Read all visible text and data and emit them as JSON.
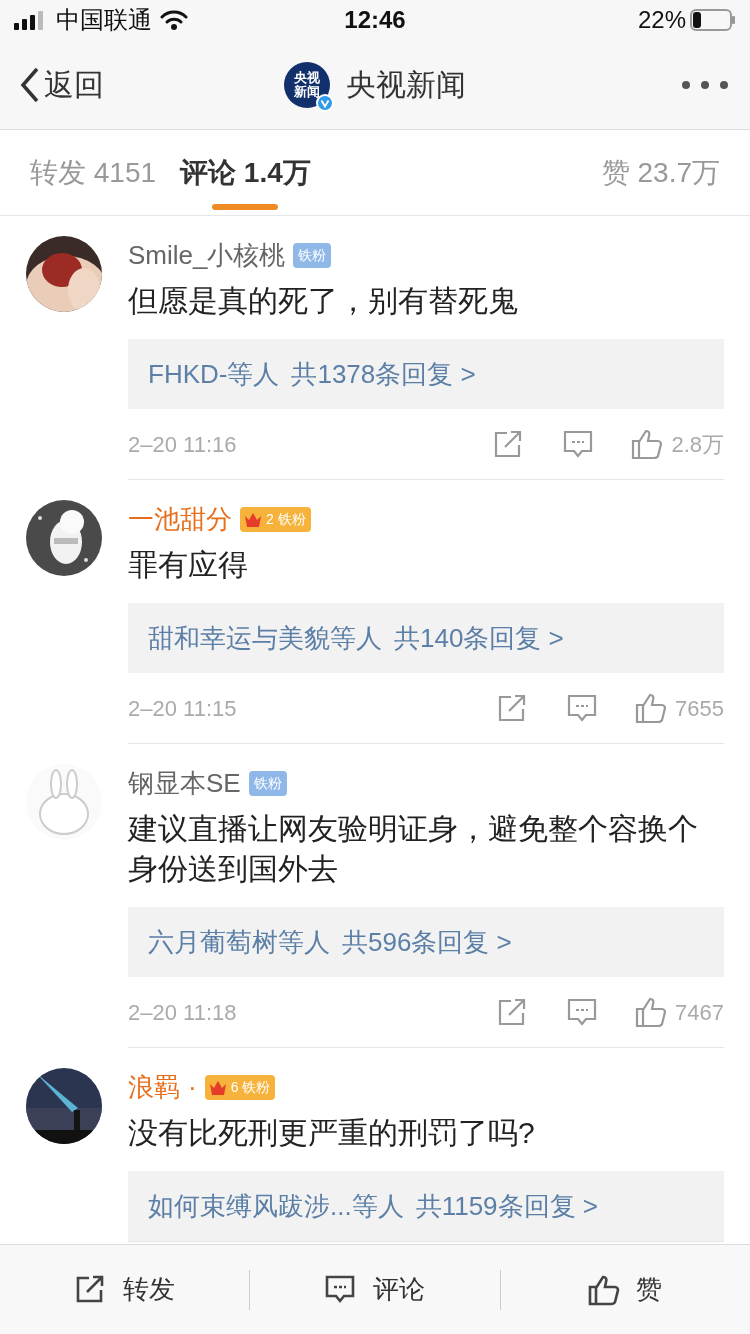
{
  "status_bar": {
    "carrier": "中国联通",
    "time": "12:46",
    "battery": "22%"
  },
  "nav": {
    "back": "返回",
    "logo_lines": [
      "央视",
      "新闻"
    ],
    "verified": true,
    "account": "央视新闻"
  },
  "tabs": [
    {
      "label": "转发",
      "count": "4151",
      "selected": false
    },
    {
      "label": "评论",
      "count": "1.4万",
      "selected": true
    },
    {
      "label": "赞",
      "count": "23.7万",
      "selected": false
    }
  ],
  "comments": [
    {
      "name": "Smile_小核桃",
      "vip": false,
      "badge": {
        "kind": "plain",
        "label": "铁粉"
      },
      "text": "但愿是真的死了，别有替死鬼",
      "replies": {
        "who": "FHKD-等人",
        "total": "共1378条回复 >"
      },
      "time": "2–20 11:16",
      "likes": "2.8万"
    },
    {
      "name": "一池甜分",
      "vip": true,
      "badge": {
        "kind": "crown",
        "label": "铁粉",
        "rank": "2"
      },
      "text": "罪有应得",
      "replies": {
        "who": "甜和幸运与美貌等人",
        "total": "共140条回复 >"
      },
      "time": "2–20 11:15",
      "likes": "7655"
    },
    {
      "name": "钢显本SE",
      "vip": false,
      "badge": {
        "kind": "plain",
        "label": "铁粉"
      },
      "text": "建议直播让网友验明证身，避免整个容换个身份送到国外去",
      "replies": {
        "who": "六月葡萄树等人",
        "total": "共596条回复 >"
      },
      "time": "2–20 11:18",
      "likes": "7467"
    },
    {
      "name": "浪羁",
      "suffix": "·",
      "vip": true,
      "badge": {
        "kind": "crown",
        "label": "铁粉",
        "rank": "6"
      },
      "text": "没有比死刑更严重的刑罚了吗?",
      "replies": {
        "who": "如何束缚风跋涉...等人",
        "total": "共1159条回复 >"
      }
    }
  ],
  "bottom_bar": [
    {
      "kind": "share",
      "label": "转发"
    },
    {
      "kind": "comment",
      "label": "评论"
    },
    {
      "kind": "like",
      "label": "赞"
    }
  ]
}
